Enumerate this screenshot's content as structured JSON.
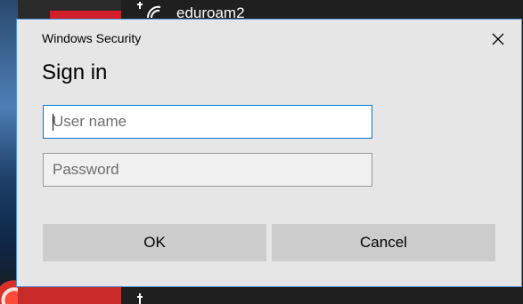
{
  "background": {
    "network_name": "eduroam2"
  },
  "dialog": {
    "header": "Windows Security",
    "title": "Sign in",
    "username_placeholder": "User name",
    "username_value": "",
    "password_placeholder": "Password",
    "password_value": "",
    "ok_label": "OK",
    "cancel_label": "Cancel"
  },
  "icons": {
    "close": "close-icon",
    "network": "wifi-secured-icon"
  },
  "colors": {
    "dialog_bg": "#e6e6e6",
    "dialog_border": "#4a90d9",
    "focus_border": "#0078d7",
    "button_bg": "#cccccc",
    "flyout_bg": "#1f1f1f",
    "accent_red": "#d11f2a"
  }
}
